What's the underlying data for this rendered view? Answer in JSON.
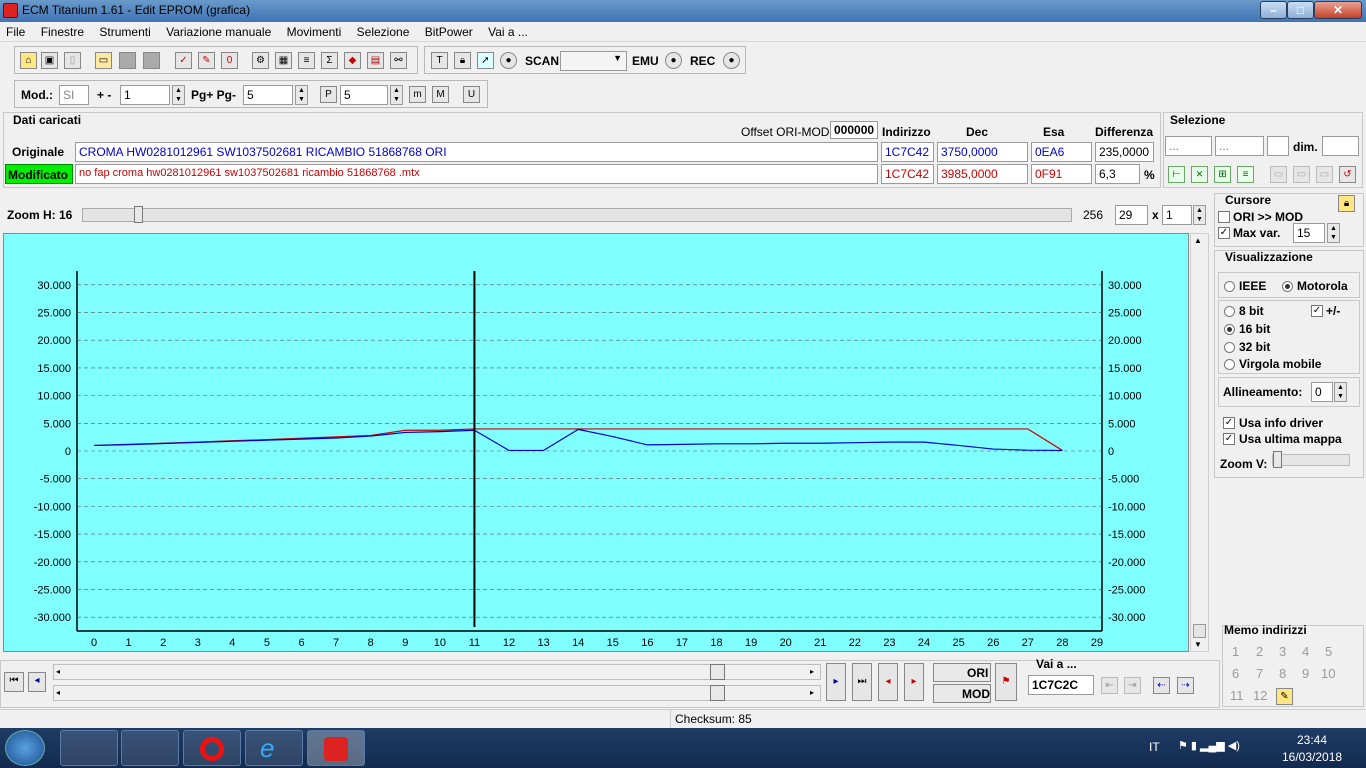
{
  "window": {
    "title": "ECM Titanium 1.61 - Edit EPROM (grafica)"
  },
  "menu": [
    "File",
    "Finestre",
    "Strumenti",
    "Variazione manuale",
    "Movimenti",
    "Selezione",
    "BitPower",
    "Vai a ..."
  ],
  "toolbar1": {
    "scan_label": "SCAN",
    "emu_label": "EMU",
    "rec_label": "REC"
  },
  "toolbar2": {
    "mod_label": "Mod.:",
    "mod_value": "SI",
    "plusminus_label": "+ -",
    "plusminus_value": "1",
    "pg_label": "Pg+ Pg-",
    "pg_value": "5",
    "p_value": "5"
  },
  "dati": {
    "title": "Dati caricati",
    "offset_label": "Offset ORI-MOD",
    "offset_value": "000000",
    "col_indirizzo": "Indirizzo",
    "col_dec": "Dec",
    "col_esa": "Esa",
    "col_diff": "Differenza",
    "orig_label": "Originale",
    "orig_name": "CROMA HW0281012961 SW1037502681 RICAMBIO 51868768 ORI",
    "orig_addr": "1C7C42",
    "orig_dec": "3750,0000",
    "orig_esa": "0EA6",
    "orig_diff": "235,0000",
    "mod_label": "Modificato",
    "mod_name": "no fap croma hw0281012961 sw1037502681 ricambio 51868768 .mtx",
    "mod_addr": "1C7C42",
    "mod_dec": "3985,0000",
    "mod_esa": "0F91",
    "mod_diff": "6,3",
    "pct": "%"
  },
  "selezione": {
    "title": "Selezione",
    "f1": "...",
    "f2": "...",
    "dim_label": "dim."
  },
  "zoom": {
    "label": "Zoom H: 16",
    "max": "256",
    "w": "29",
    "x": "x",
    "h": "1"
  },
  "cursore": {
    "title": "Cursore",
    "ori_mod": "ORI >> MOD",
    "max_var": "Max var.",
    "max_var_value": "15"
  },
  "visual": {
    "title": "Visualizzazione",
    "ieee": "IEEE",
    "motorola": "Motorola",
    "b8": "8 bit",
    "b16": "16 bit",
    "b32": "32 bit",
    "virgola": "Virgola mobile",
    "pm": "+/-",
    "allineamento": "Allineamento:",
    "allineamento_value": "0",
    "usa_info": "Usa info driver",
    "usa_ultima": "Usa ultima mappa",
    "zoomv": "Zoom V:"
  },
  "memo": {
    "title": "Memo indirizzi",
    "items": [
      "1",
      "2",
      "3",
      "4",
      "5",
      "6",
      "7",
      "8",
      "9",
      "10",
      "11",
      "12"
    ]
  },
  "bottom": {
    "ori": "ORI",
    "mod": "MOD",
    "vai": "Vai a ...",
    "vai_value": "1C7C2C"
  },
  "status": {
    "checksum": "Checksum: 85"
  },
  "taskbar": {
    "lang": "IT",
    "time": "23:44",
    "date": "16/03/2018"
  },
  "colors": {
    "plot_bg": "#80ffff",
    "ori": "#0000cc",
    "mod": "#cc0000",
    "mod_badge": "#00ee00"
  },
  "chart_data": {
    "type": "line",
    "x": [
      0,
      1,
      2,
      3,
      4,
      5,
      6,
      7,
      8,
      9,
      10,
      11,
      12,
      13,
      14,
      15,
      16,
      17,
      18,
      19,
      20,
      21,
      22,
      23,
      24,
      25,
      26,
      27,
      28
    ],
    "xlim": [
      0,
      29
    ],
    "ylim": [
      -32500,
      32500
    ],
    "yticks": [
      30000,
      25000,
      20000,
      15000,
      10000,
      5000,
      0,
      -5000,
      -10000,
      -15000,
      -20000,
      -25000,
      -30000
    ],
    "ytick_labels": [
      "30.000",
      "25.000",
      "20.000",
      "15.000",
      "10.000",
      "5.000",
      "0",
      "-5.000",
      "-10.000",
      "-15.000",
      "-20.000",
      "-25.000",
      "-30.000"
    ],
    "xtick_labels": [
      "0",
      "1",
      "2",
      "3",
      "4",
      "5",
      "6",
      "7",
      "8",
      "9",
      "10",
      "11",
      "12",
      "13",
      "14",
      "15",
      "16",
      "17",
      "18",
      "19",
      "20",
      "21",
      "22",
      "23",
      "24",
      "25",
      "26",
      "27",
      "28",
      "29"
    ],
    "cursor_x": 11,
    "grid": true,
    "series": [
      {
        "values": [
          1000,
          1150,
          1350,
          1550,
          1750,
          1950,
          2150,
          2350,
          2700,
          3350,
          3500,
          3750,
          100,
          100,
          3900,
          2600,
          1100,
          1200,
          1300,
          1300,
          1400,
          1400,
          1500,
          1600,
          1600,
          1000,
          350,
          150,
          100
        ]
      },
      {
        "values": [
          1000,
          1200,
          1400,
          1600,
          1850,
          2050,
          2300,
          2550,
          2800,
          3750,
          3750,
          3985,
          3985,
          3985,
          3985,
          3985,
          3985,
          3985,
          3985,
          3985,
          3985,
          3985,
          3985,
          3985,
          3985,
          3985,
          3985,
          3985,
          100
        ]
      }
    ]
  }
}
